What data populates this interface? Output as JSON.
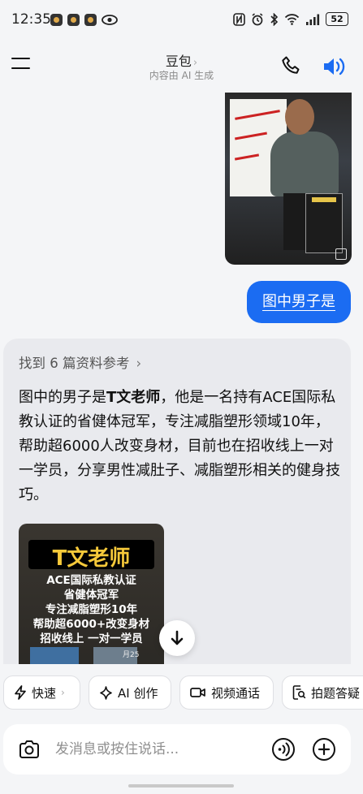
{
  "status_bar": {
    "time": "12:35",
    "battery": "52"
  },
  "header": {
    "title": "豆包",
    "title_chevron": "›",
    "subtitle": "内容由 AI 生成"
  },
  "messages": {
    "user_text": "图中男子是",
    "references": "找到 6 篇资料参考",
    "references_chevron": "›",
    "reply_name": "T文老师",
    "reply_before": "图中的男子是",
    "reply_after": "，他是一名持有ACE国际私教认证的省健体冠军，专注减脂塑形领域10年，帮助超6000人改变身材，目前也在招收线上一对一学员，分享男性减肚子、减脂塑形相关的健身技巧。",
    "image_caption": {
      "title": "T文老师",
      "line1": "ACE国际私教认证",
      "line2": "省健体冠军",
      "line3": "专注减脂塑形10年",
      "line4": "帮助超6000+改变身材",
      "line5": "招收线上 一对一学员",
      "date": "月25"
    }
  },
  "chips": [
    {
      "label": "快速",
      "icon": "lightning-icon",
      "chevron": "›"
    },
    {
      "label": "AI 创作",
      "icon": "sparkle-icon"
    },
    {
      "label": "视频通话",
      "icon": "video-icon"
    },
    {
      "label": "拍题答疑",
      "icon": "search-doc-icon"
    }
  ],
  "input": {
    "placeholder": "发消息或按住说话..."
  },
  "colors": {
    "accent": "#1b6cf2",
    "background": "#f4f5f7",
    "card": "#e9eaee"
  }
}
